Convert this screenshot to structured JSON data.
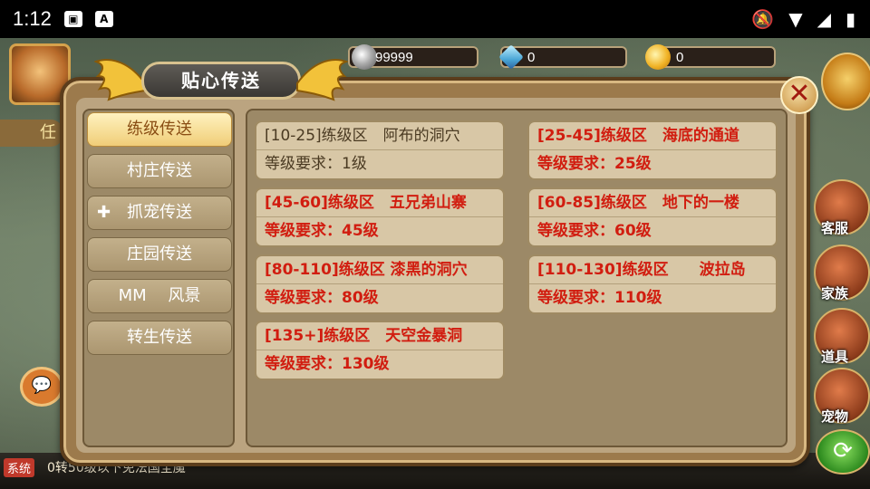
{
  "status_bar": {
    "time": "1:12",
    "left_icons": [
      "image-icon",
      "a-icon"
    ],
    "right_icons": [
      "mute-icon",
      "wifi-icon",
      "signal-icon",
      "battery-icon"
    ]
  },
  "hud": {
    "currencies": [
      {
        "name": "silver",
        "icon": "silver-coin-icon",
        "value": "99999"
      },
      {
        "name": "crystal",
        "icon": "crystal-icon",
        "value": "0"
      },
      {
        "name": "gold",
        "icon": "gold-coin-icon",
        "value": "0"
      }
    ],
    "side_buttons": [
      {
        "label": "客服",
        "icon": "customer-service-icon"
      },
      {
        "label": "家族",
        "icon": "family-icon"
      },
      {
        "label": "道具",
        "icon": "items-icon"
      },
      {
        "label": "宠物",
        "icon": "pet-icon"
      }
    ],
    "left_tag": "任",
    "system_tag": "系统",
    "system_text": "0转50级以下免法国全魔"
  },
  "dialog": {
    "title": "贴心传送",
    "close_label": "✕",
    "categories": [
      {
        "label": "练级传送",
        "active": true,
        "plus": false
      },
      {
        "label": "村庄传送",
        "active": false,
        "plus": false
      },
      {
        "label": "抓宠传送",
        "active": false,
        "plus": true
      },
      {
        "label": "庄园传送",
        "active": false,
        "plus": false
      },
      {
        "label": "MM　 风景",
        "active": false,
        "plus": false
      },
      {
        "label": "转生传送",
        "active": false,
        "plus": false
      }
    ],
    "plus_symbol": "✚",
    "destinations": [
      {
        "name": "[10-25]练级区　阿布的洞穴",
        "req": "等级要求：1级",
        "highlight": false
      },
      {
        "name": "[25-45]练级区　海底的通道",
        "req": "等级要求：25级",
        "highlight": true
      },
      {
        "name": "[45-60]练级区　五兄弟山寨",
        "req": "等级要求：45级",
        "highlight": true
      },
      {
        "name": "[60-85]练级区　地下的一楼",
        "req": "等级要求：60级",
        "highlight": true
      },
      {
        "name": "[80-110]练级区 漆黑的洞穴",
        "req": "等级要求：80级",
        "highlight": true
      },
      {
        "name": "[110-130]练级区　　波拉岛",
        "req": "等级要求：110级",
        "highlight": true
      },
      {
        "name": " [135+]练级区　天空金暴洞",
        "req": "等级要求：130级",
        "highlight": true
      }
    ]
  },
  "colors": {
    "highlight_text": "#d11d10",
    "normal_text": "#4a3a22",
    "active_tab": "#f0cd78"
  }
}
